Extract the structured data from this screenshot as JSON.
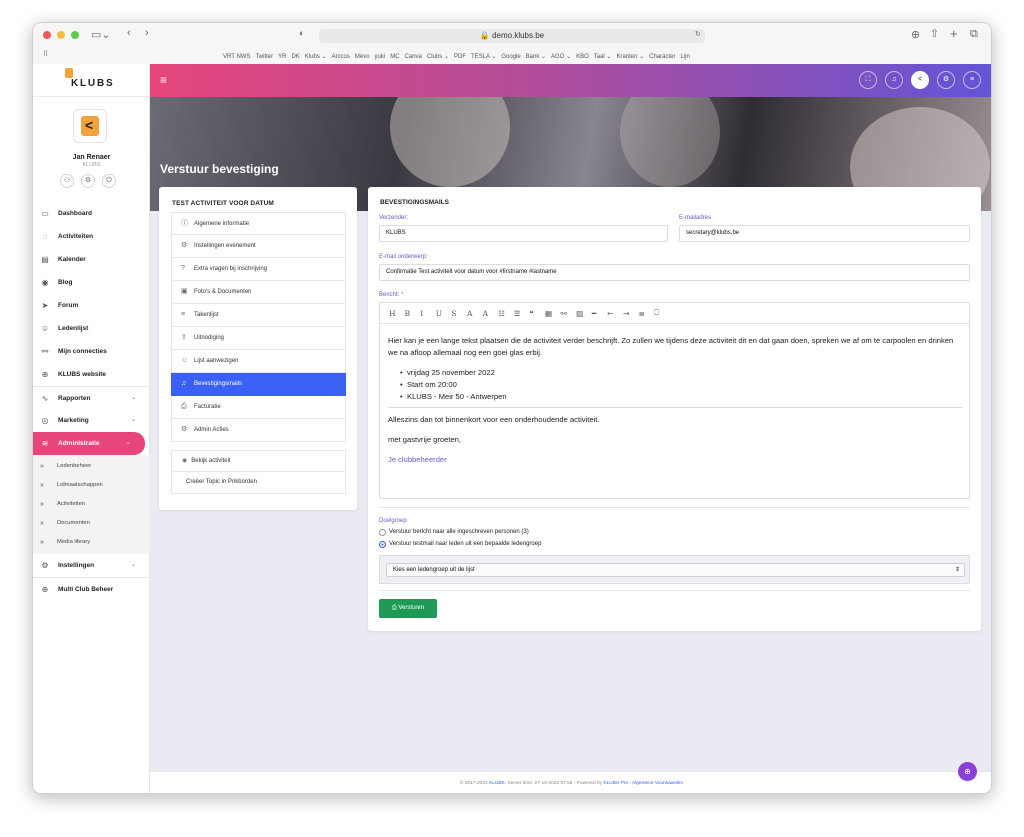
{
  "browser": {
    "url": "demo.klubs.be",
    "bookmarks": [
      "VRT NWS",
      "Twitter",
      "YR",
      "DK",
      "Klubs ⌄",
      "Arccos",
      "Mevo",
      "yuki",
      "MC",
      "Canva",
      "Clubs ⌄",
      "PDF",
      "TESLA ⌄",
      "Google",
      "Bank ⌄",
      "AGO ⌄",
      "KBO",
      "Taal ⌄",
      "Kranten ⌄",
      "Character",
      "Lijn"
    ]
  },
  "sidebar": {
    "logo": "KLUBS",
    "user_name": "Jan Renaer",
    "user_club": "KLUBS",
    "items": [
      {
        "label": "Dashboard",
        "icon": "monitor-icon"
      },
      {
        "label": "Activiteiten",
        "icon": "circle-icon"
      },
      {
        "label": "Kalender",
        "icon": "calendar-icon"
      },
      {
        "label": "Blog",
        "icon": "broadcast-icon"
      },
      {
        "label": "Forum",
        "icon": "send-icon"
      },
      {
        "label": "Ledenlijst",
        "icon": "users-icon"
      },
      {
        "label": "Mijn connecties",
        "icon": "link-icon"
      },
      {
        "label": "KLUBS website",
        "icon": "globe-icon"
      }
    ],
    "groups": [
      {
        "label": "Rapporten",
        "icon": "chart-icon"
      },
      {
        "label": "Marketing",
        "icon": "target-icon"
      },
      {
        "label": "Administratie",
        "icon": "layers-icon"
      }
    ],
    "sub_items": [
      "Ledenbeheer",
      "Lidmaatschappen",
      "Activiteiten",
      "Documenten",
      "Media library"
    ],
    "settings": "Instellingen",
    "multi": "Multi Club Beheer"
  },
  "page": {
    "title": "Verstuur bevestiging"
  },
  "left_panel": {
    "heading": "TEST ACTIVITEIT VOOR DATUM",
    "items": [
      {
        "label": "Algemene informatie",
        "icon": "ⓘ"
      },
      {
        "label": "Instellingen evenement",
        "icon": "⚙"
      },
      {
        "label": "Extra vragen bij inschrijving",
        "icon": "?"
      },
      {
        "label": "Foto's & Documenten",
        "icon": "▣"
      },
      {
        "label": "Takenlijst",
        "icon": "≡"
      },
      {
        "label": "Uitnodiging",
        "icon": "⇪"
      },
      {
        "label": "Lijst aanwezigen",
        "icon": "☺"
      },
      {
        "label": "Bevestigingsmails",
        "icon": "♫"
      },
      {
        "label": "Facturatie",
        "icon": "⎙"
      },
      {
        "label": "Admin Acties",
        "icon": "⚙"
      }
    ],
    "extra": [
      {
        "label": "Bekijk activiteit",
        "icon": "◉"
      },
      {
        "label": "Creëer Topic in Prikborden",
        "icon": ""
      }
    ]
  },
  "form": {
    "heading": "BEVESTIGINGSMAILS",
    "sender_label": "Verzender:",
    "sender_value": "KLUBS",
    "email_label": "E-mailadres",
    "email_value": "secretary@klubs.be",
    "subject_label": "E-mail onderwerp:",
    "subject_value": "Confirmatie Test activiteit voor datum voor #firstname #lastname",
    "message_label": "Bericht:",
    "required_mark": "*",
    "toolbar": [
      "H",
      "B",
      "I",
      "U",
      "S",
      "A",
      "A",
      "☷",
      "☰",
      "❝",
      "▦",
      "⚯",
      "▨",
      "━",
      "⇤",
      "⇥",
      "≣",
      "⎕"
    ],
    "message_p1": "Hier kan je een lange tekst plaatsen die de activiteit verder beschrijft. Zo zullen we tijdens deze activiteit dit en dat gaan doen, spreken we af om te carpoolen en drinken we na afloop allemaal nog een goei glas erbij.",
    "message_list": [
      "vrijdag 25 november 2022",
      "Start om 20:00",
      "KLUBS - Meir 50 - Antwerpen"
    ],
    "message_p2": "Alleszins dan tot binnenkort voor een onderhoudende activiteit.",
    "message_p3": "met gastvrije groeten,",
    "message_sig": "Je clubbeheerder",
    "target_label": "Doelgroep",
    "radio1": "Verstuur bericht naar alle ingeschreven personen (3)",
    "radio2": "Verstuur testmail naar leden uit een bepaalde ledengroep",
    "select_value": "Kies een ledengroep uit de lijst",
    "send_label": "Versturen"
  },
  "footer": {
    "pre": "© 2017-2022",
    "brand": "KLUBS",
    "mid": ". Server time: 27-10-2022 07:55 - Powered by",
    "pro": "KLUBS Pro",
    "sep": " - ",
    "terms": "Algemene Voorwaarden"
  },
  "colors": {
    "accent": "#3a60f5",
    "brand": "#e6457b",
    "success": "#1e9a56"
  }
}
